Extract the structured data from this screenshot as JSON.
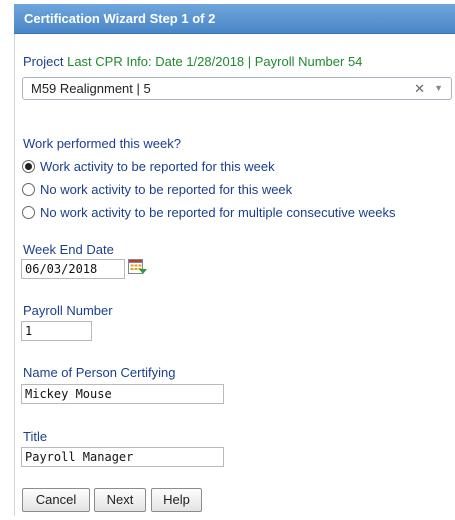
{
  "wizard": {
    "title": "Certification Wizard Step 1 of 2"
  },
  "project": {
    "label": "Project",
    "info": "Last CPR Info: Date 1/28/2018 | Payroll Number 54",
    "selected": "M59 Realignment | 5"
  },
  "work": {
    "question": "Work performed this week?",
    "options": [
      {
        "label": "Work activity to be reported for this week",
        "checked": true
      },
      {
        "label": "No work activity to be reported for this week",
        "checked": false
      },
      {
        "label": "No work activity to be reported for multiple consecutive weeks",
        "checked": false
      }
    ]
  },
  "week_end": {
    "label": "Week End Date",
    "value": "06/03/2018"
  },
  "payroll": {
    "label": "Payroll Number",
    "value": "1"
  },
  "certifier": {
    "label": "Name of Person Certifying",
    "value": "Mickey Mouse"
  },
  "title_field": {
    "label": "Title",
    "value": "Payroll Manager"
  },
  "buttons": {
    "cancel": "Cancel",
    "next": "Next",
    "help": "Help"
  },
  "colors": {
    "header": "#4a86c8",
    "label": "#1a3f8f",
    "info": "#1e8a2e"
  }
}
